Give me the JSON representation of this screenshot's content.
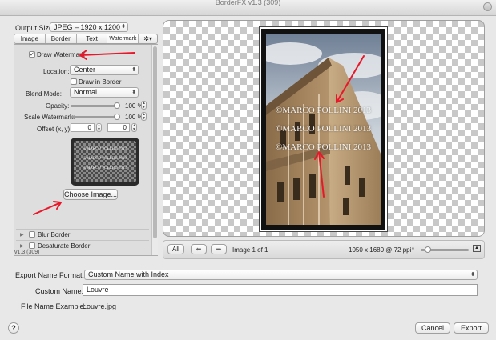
{
  "window": {
    "title": "BorderFX v1.3 (309)"
  },
  "output_size": {
    "label": "Output Size:",
    "value": "JPEG – 1920 x 1200"
  },
  "tabs": [
    {
      "label": "Image"
    },
    {
      "label": "Border"
    },
    {
      "label": "Text"
    },
    {
      "label": "Watermark"
    },
    {
      "label": "✲▾"
    }
  ],
  "watermark": {
    "draw_label": "Draw Watermark",
    "draw_checked": true,
    "location_label": "Location:",
    "location_value": "Center",
    "draw_in_border_label": "Draw in Border",
    "draw_in_border_checked": false,
    "blend_label": "Blend Mode:",
    "blend_value": "Normal",
    "opacity_label": "Opacity:",
    "opacity_value": "100 %",
    "opacity_level": 1.0,
    "scale_label": "Scale Watermark:",
    "scale_value": "100 %",
    "scale_level": 1.0,
    "offset_label": "Offset (x, y):",
    "offset_x": "0",
    "offset_y": "0",
    "choose_button": "Choose Image..."
  },
  "sections": {
    "blur_border": "Blur Border",
    "desaturate_border": "Desaturate Border"
  },
  "version_label": "v1.3 (309)",
  "watermark_text": "©MARCO POLLINI 2013",
  "preview_toolbar": {
    "all_button": "All",
    "prev_icon": "left-arrow-icon",
    "next_icon": "right-arrow-icon",
    "page_text": "Image 1 of 1",
    "dimensions_text": "1050 x 1680 @ 72 ppi",
    "zoom_level": 0.1
  },
  "export": {
    "format_label": "Export Name Format:",
    "format_value": "Custom Name with Index",
    "custom_name_label": "Custom Name:",
    "custom_name_value": "Louvre",
    "example_label": "File Name Example:",
    "example_value": "Louvre.jpg"
  },
  "buttons": {
    "help": "?",
    "cancel": "Cancel",
    "export": "Export"
  },
  "colors": {
    "annotation_red": "#e8182a",
    "checker_dark": "#c8c8c8"
  }
}
